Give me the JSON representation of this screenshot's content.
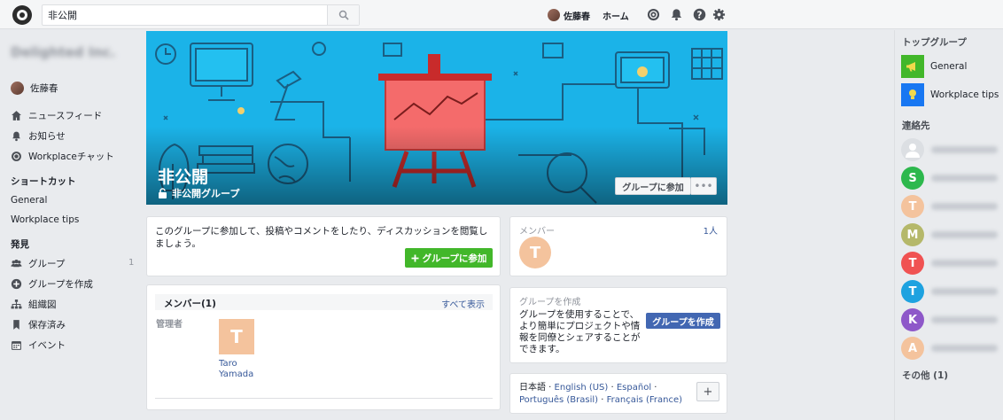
{
  "topbar": {
    "search_value": "非公開",
    "user_name": "佐藤春",
    "home_label": "ホーム",
    "icons": [
      "workplace-chat-icon",
      "bell-icon",
      "help-icon",
      "gear-icon"
    ]
  },
  "sidebar": {
    "user_name": "佐藤春",
    "main_items": [
      {
        "label": "ニュースフィード",
        "icon": "home-icon"
      },
      {
        "label": "お知らせ",
        "icon": "bell-icon"
      },
      {
        "label": "Workplaceチャット",
        "icon": "chat-icon"
      }
    ],
    "shortcuts_header": "ショートカット",
    "shortcuts": [
      "General",
      "Workplace tips"
    ],
    "discover_header": "発見",
    "discover_items": [
      {
        "label": "グループ",
        "icon": "groups-icon",
        "count": "1"
      },
      {
        "label": "グループを作成",
        "icon": "plus-circle-icon"
      },
      {
        "label": "組織図",
        "icon": "org-chart-icon"
      },
      {
        "label": "保存済み",
        "icon": "bookmark-icon"
      },
      {
        "label": "イベント",
        "icon": "calendar-icon"
      }
    ]
  },
  "cover": {
    "title": "非公開",
    "subtitle": "非公開グループ",
    "join_label": "グループに参加",
    "more_label": "•••"
  },
  "join_card": {
    "message": "このグループに参加して、投稿やコメントをしたり、ディスカッションを閲覧しましょう。",
    "button_label": "グループに参加"
  },
  "members_card": {
    "title": "メンバー(1)",
    "see_all": "すべて表示",
    "admin_label": "管理者",
    "admin_initial": "T",
    "admin_name_line1": "Taro",
    "admin_name_line2": "Yamada"
  },
  "right_members": {
    "label": "メンバー",
    "count": "1人",
    "initial": "T"
  },
  "create_group": {
    "title": "グループを作成",
    "description": "グループを使用することで、より簡単にプロジェクトや情報を同僚とシェアすることができます。",
    "button_label": "グループを作成"
  },
  "languages": {
    "current": "日本語",
    "options": [
      "English (US)",
      "Español",
      "Português (Brasil)",
      "Français (France)"
    ],
    "separator": " · ",
    "add_label": "+"
  },
  "right_sidebar": {
    "top_groups_header": "トップグループ",
    "top_groups": [
      {
        "name": "General",
        "color": "#42b72a"
      },
      {
        "name": "Workplace tips",
        "color": "#1877f2"
      }
    ],
    "contacts_header": "連絡先",
    "contacts": [
      {
        "initial": "",
        "color": "#dcdfe3"
      },
      {
        "initial": "S",
        "color": "#2db84d"
      },
      {
        "initial": "T",
        "color": "#f4c39d"
      },
      {
        "initial": "M",
        "color": "#b5b86a"
      },
      {
        "initial": "T",
        "color": "#f05252"
      },
      {
        "initial": "T",
        "color": "#1ea2e0"
      },
      {
        "initial": "K",
        "color": "#8e58c9"
      },
      {
        "initial": "A",
        "color": "#f4c39d"
      }
    ],
    "other_label": "その他 (1)"
  }
}
